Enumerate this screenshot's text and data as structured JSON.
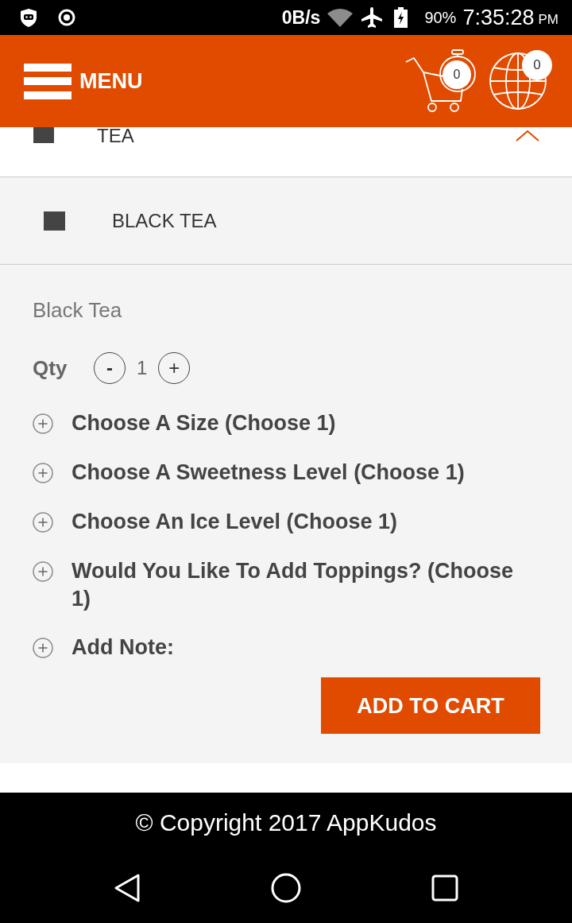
{
  "status_bar": {
    "net_speed": "0B/s",
    "battery": "90%",
    "time": "7:35:28",
    "period": "PM"
  },
  "header": {
    "menu_label": "MENU",
    "cart_count": "0",
    "globe_count": "0"
  },
  "category": {
    "label": "TEA",
    "expanded": true
  },
  "subcategory": {
    "label": "BLACK TEA"
  },
  "product": {
    "name": "Black Tea",
    "qty_label": "Qty",
    "qty_minus": "-",
    "qty_value": "1",
    "qty_plus": "+",
    "options": [
      {
        "label": "Choose A Size (Choose 1)",
        "expanded": false
      },
      {
        "label": "Choose A Sweetness Level (Choose 1)",
        "expanded": false
      },
      {
        "label": "Choose An Ice Level (Choose 1)",
        "expanded": false
      },
      {
        "label": "Would You Like To Add Toppings? (Choose 1)",
        "expanded": false
      },
      {
        "label": "Add Note:",
        "expanded": false
      }
    ],
    "add_button": "ADD TO CART"
  },
  "footer": {
    "copyright": "© Copyright 2017 AppKudos"
  }
}
